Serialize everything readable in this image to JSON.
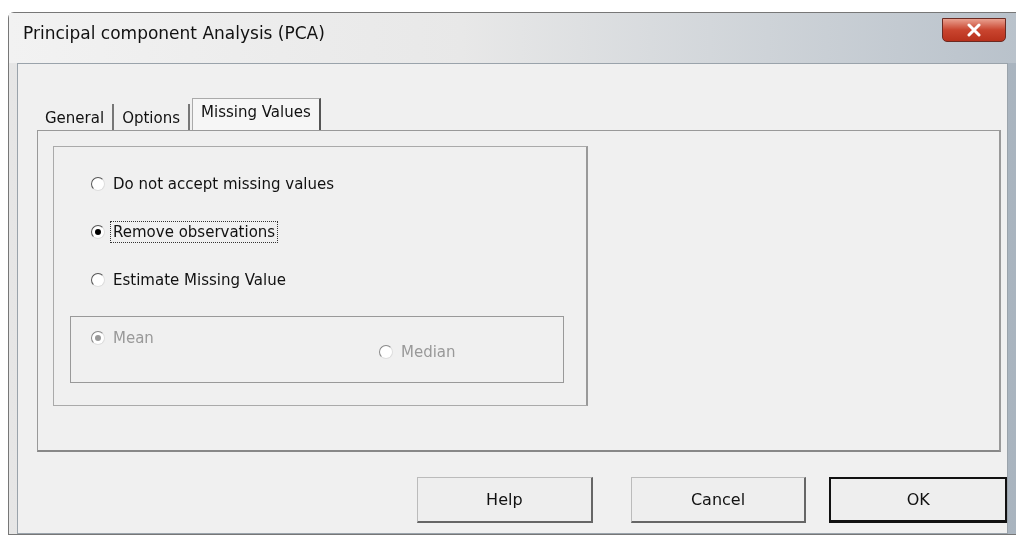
{
  "window": {
    "title": "Principal component Analysis (PCA)"
  },
  "tabs": [
    {
      "label": "General",
      "selected": false
    },
    {
      "label": "Options",
      "selected": false
    },
    {
      "label": "Missing Values",
      "selected": true
    }
  ],
  "options": [
    {
      "label": "Do not accept missing values",
      "selected": false,
      "focused": false
    },
    {
      "label": "Remove observations",
      "selected": true,
      "focused": true
    },
    {
      "label": "Estimate Missing Value",
      "selected": false,
      "focused": false
    }
  ],
  "estimate_options": [
    {
      "label": "Mean",
      "selected": true,
      "disabled": true
    },
    {
      "label": "Median",
      "selected": false,
      "disabled": true
    }
  ],
  "buttons": [
    {
      "label": "Help",
      "default": false
    },
    {
      "label": "Cancel",
      "default": false
    },
    {
      "label": "OK",
      "default": true
    }
  ]
}
